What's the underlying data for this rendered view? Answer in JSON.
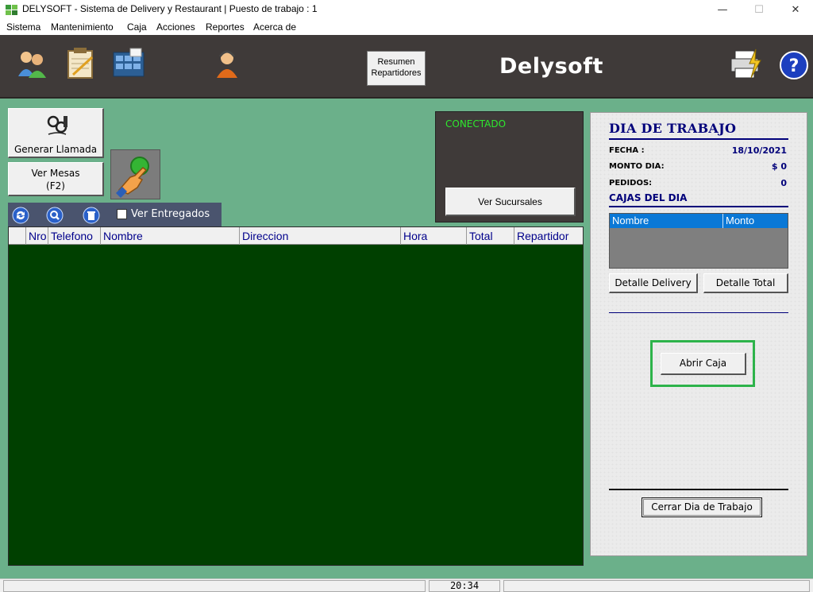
{
  "window": {
    "title": "DELYSOFT - Sistema de Delivery y Restaurant  |  Puesto de trabajo : 1",
    "minimize_glyph": "—",
    "maximize_glyph": "☐",
    "close_glyph": "✕"
  },
  "menu": [
    "Sistema",
    "Mantenimiento",
    "Caja",
    "Acciones",
    "Reportes",
    "Acerca de"
  ],
  "toolbar": {
    "icons": [
      "users-icon",
      "notepad-icon",
      "tables-icon",
      "operator-icon"
    ],
    "resumen_line1": "Resumen",
    "resumen_line2": "Repartidores",
    "brand": "Delysoft",
    "right_icons": [
      "printer-icon",
      "help-icon"
    ]
  },
  "left": {
    "generar_llamada": "Generar Llamada",
    "ver_mesas_line1": "Ver Mesas",
    "ver_mesas_line2": "(F2)"
  },
  "grid_toolbar": {
    "icons": [
      "refresh-icon",
      "search-icon",
      "trash-icon"
    ],
    "ver_entregados": "Ver Entregados"
  },
  "grid": {
    "columns": [
      "Nro",
      "Telefono",
      "Nombre",
      "Direccion",
      "Hora",
      "Total",
      "Repartidor"
    ],
    "rows": []
  },
  "connection": {
    "status": "CONECTADO",
    "ver_sucursales": "Ver Sucursales"
  },
  "dia_trabajo": {
    "title": "DIA DE TRABAJO",
    "fecha_label": "FECHA :",
    "fecha_value": "18/10/2021",
    "monto_label": "MONTO DIA:",
    "monto_value": "$ 0",
    "pedidos_label": "PEDIDOS:",
    "pedidos_value": "0",
    "cajas_title": "CAJAS DEL DIA",
    "cajas_columns": [
      "Nombre",
      "Monto"
    ],
    "detalle_delivery": "Detalle Delivery",
    "detalle_total": "Detalle Total",
    "abrir_caja": "Abrir Caja",
    "cerrar_dia": "Cerrar Dia de Trabajo"
  },
  "status_bar": {
    "time": "20:34"
  },
  "colors": {
    "toolbar_bg": "#3f3a39",
    "main_bg": "#6bb08a",
    "grid_bg": "#004000",
    "header_text": "#00008b",
    "conectado": "#2ee82e",
    "highlight_frame": "#2db34a"
  }
}
